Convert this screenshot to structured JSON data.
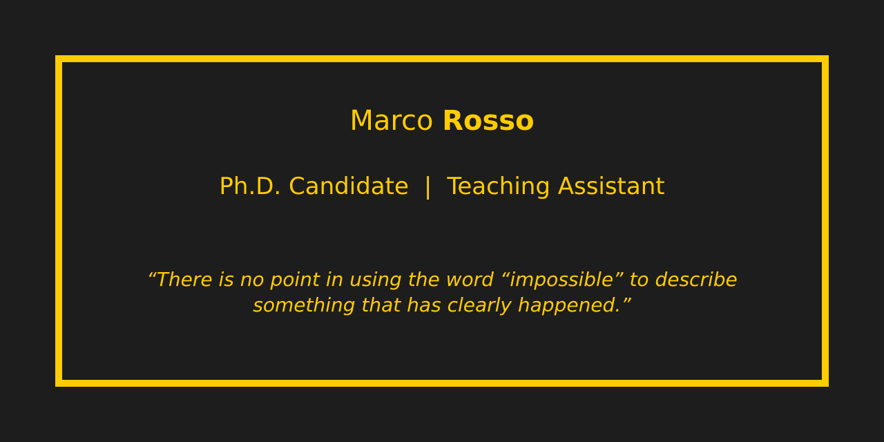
{
  "colors": {
    "background": "#1d1d1d",
    "accent": "#ffcc00"
  },
  "profile": {
    "first_name": "Marco",
    "last_name": "Rosso",
    "role_primary": "Ph.D. Candidate",
    "role_separator": "|",
    "role_secondary": "Teaching Assistant",
    "quote_line_1": "“There is no point in using the word “impossible” to describe",
    "quote_line_2": "something that has clearly happened.”"
  }
}
